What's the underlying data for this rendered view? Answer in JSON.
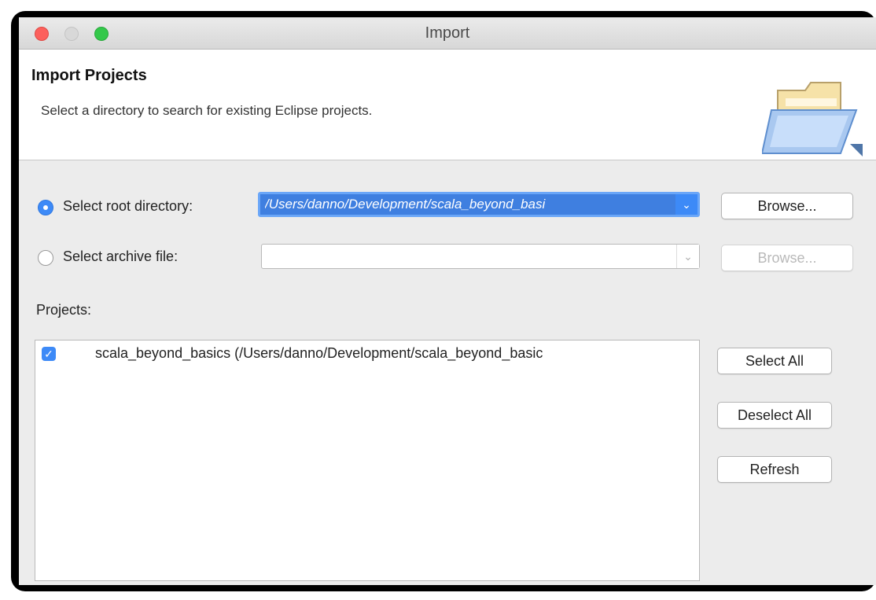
{
  "window": {
    "title": "Import"
  },
  "banner": {
    "title": "Import Projects",
    "description": "Select a directory to search for existing Eclipse projects.",
    "icon": "folder-open-icon"
  },
  "source": {
    "root_label": "Select root directory:",
    "root_value": "/Users/danno/Development/scala_beyond_basi",
    "root_selected": true,
    "archive_label": "Select archive file:",
    "archive_value": "",
    "archive_selected": false,
    "browse_label": "Browse...",
    "browse_disabled_label": "Browse..."
  },
  "projects": {
    "label": "Projects:",
    "items": [
      {
        "label": "scala_beyond_basics (/Users/danno/Development/scala_beyond_basic",
        "checked": true
      }
    ],
    "select_all": "Select All",
    "deselect_all": "Deselect All",
    "refresh": "Refresh"
  },
  "colors": {
    "accent": "#3d8af7",
    "close": "#fc605c",
    "maximize": "#34c84a"
  }
}
